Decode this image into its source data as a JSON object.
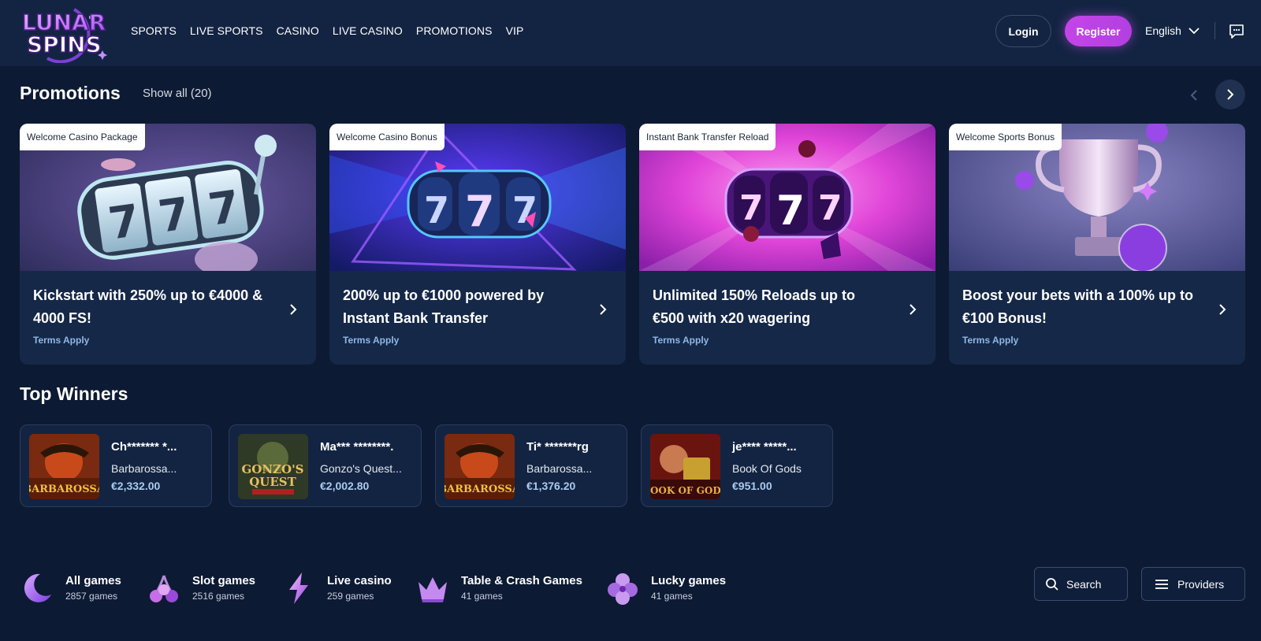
{
  "header": {
    "logo_text": "LUNAR SPINS",
    "nav": [
      "SPORTS",
      "LIVE SPORTS",
      "CASINO",
      "LIVE CASINO",
      "PROMOTIONS",
      "VIP"
    ],
    "login_label": "Login",
    "register_label": "Register",
    "language": "English"
  },
  "promotions": {
    "title": "Promotions",
    "show_all": "Show all (20)",
    "cards": [
      {
        "tag": "Welcome Casino Package",
        "title": "Kickstart with 250% up to €4000 & 4000 FS!",
        "terms": "Terms Apply"
      },
      {
        "tag": "Welcome Casino Bonus",
        "title": "200% up to €1000 powered by Instant Bank Transfer",
        "terms": "Terms Apply"
      },
      {
        "tag": "Instant Bank Transfer Reload",
        "title": "Unlimited 150% Reloads up to €500 with x20 wagering",
        "terms": "Terms Apply"
      },
      {
        "tag": "Welcome Sports Bonus",
        "title": "Boost your bets with a 100% up to €100 Bonus!",
        "terms": "Terms Apply"
      }
    ]
  },
  "top_winners": {
    "title": "Top Winners",
    "winners": [
      {
        "name": "Ch******* *...",
        "game": "Barbarossa...",
        "amount": "€2,332.00"
      },
      {
        "name": "Ma*** ********.",
        "game": "Gonzo's Quest...",
        "amount": "€2,002.80"
      },
      {
        "name": "Ti* *******rg",
        "game": "Barbarossa...",
        "amount": "€1,376.20"
      },
      {
        "name": "je**** *****...",
        "game": "Book Of Gods",
        "amount": "€951.00"
      }
    ]
  },
  "categories": [
    {
      "label": "All games",
      "count": "2857 games",
      "icon": "moon-icon"
    },
    {
      "label": "Slot games",
      "count": "2516 games",
      "icon": "cherries-icon"
    },
    {
      "label": "Live casino",
      "count": "259 games",
      "icon": "lightning-icon"
    },
    {
      "label": "Table & Crash Games",
      "count": "41 games",
      "icon": "crown-icon"
    },
    {
      "label": "Lucky games",
      "count": "41 games",
      "icon": "clover-icon"
    }
  ],
  "search_label": "Search",
  "providers_label": "Providers",
  "colors": {
    "background": "#0d1a33",
    "header": "#132442",
    "card": "#152848",
    "accent": "#c445e8",
    "terms": "#8fb8e8"
  }
}
